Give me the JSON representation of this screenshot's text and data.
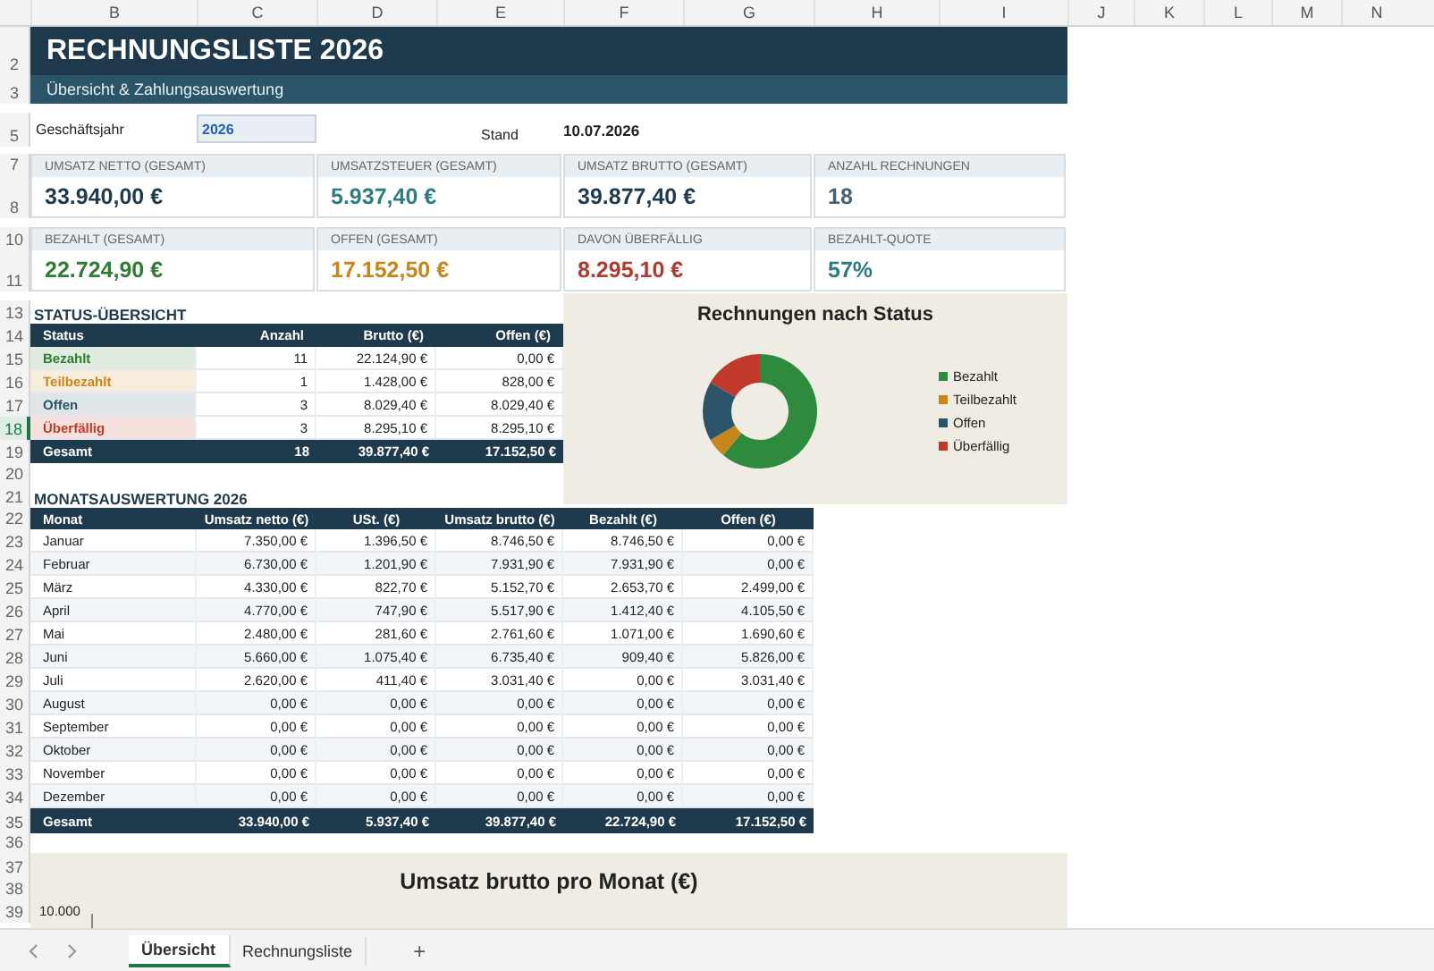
{
  "column_headers": [
    "B",
    "C",
    "D",
    "E",
    "F",
    "G",
    "H",
    "I",
    "J",
    "K",
    "L",
    "M",
    "N"
  ],
  "row_headers": [
    {
      "label": "2",
      "selected": false
    },
    {
      "label": "3",
      "selected": false
    },
    {
      "label": "5",
      "selected": false
    },
    {
      "label": "7",
      "selected": false
    },
    {
      "label": "8",
      "selected": false
    },
    {
      "label": "10",
      "selected": false
    },
    {
      "label": "11",
      "selected": false
    },
    {
      "label": "13",
      "selected": false
    },
    {
      "label": "14",
      "selected": false
    },
    {
      "label": "15",
      "selected": false
    },
    {
      "label": "16",
      "selected": false
    },
    {
      "label": "17",
      "selected": false
    },
    {
      "label": "18",
      "selected": true
    },
    {
      "label": "19",
      "selected": false
    },
    {
      "label": "20",
      "selected": false
    },
    {
      "label": "21",
      "selected": false
    },
    {
      "label": "22",
      "selected": false
    },
    {
      "label": "23",
      "selected": false
    },
    {
      "label": "24",
      "selected": false
    },
    {
      "label": "25",
      "selected": false
    },
    {
      "label": "26",
      "selected": false
    },
    {
      "label": "27",
      "selected": false
    },
    {
      "label": "28",
      "selected": false
    },
    {
      "label": "29",
      "selected": false
    },
    {
      "label": "30",
      "selected": false
    },
    {
      "label": "31",
      "selected": false
    },
    {
      "label": "32",
      "selected": false
    },
    {
      "label": "33",
      "selected": false
    },
    {
      "label": "34",
      "selected": false
    },
    {
      "label": "35",
      "selected": false
    },
    {
      "label": "36",
      "selected": false
    },
    {
      "label": "37",
      "selected": false
    },
    {
      "label": "38",
      "selected": false
    },
    {
      "label": "39",
      "selected": false
    }
  ],
  "title": "RECHNUNGSLISTE 2026",
  "subtitle": "Übersicht & Zahlungsauswertung",
  "fiscal_year": {
    "label": "Geschäftsjahr",
    "value": "2026"
  },
  "as_of": {
    "label": "Stand",
    "value": "10.07.2026"
  },
  "kpis": [
    {
      "label": "UMSATZ NETTO (GESAMT)",
      "value": "33.940,00 €",
      "color": "#1f3a4d"
    },
    {
      "label": "UMSATZSTEUER (GESAMT)",
      "value": "5.937,40 €",
      "color": "#2e7d7d"
    },
    {
      "label": "UMSATZ BRUTTO (GESAMT)",
      "value": "39.877,40 €",
      "color": "#1f3a4d"
    },
    {
      "label": "ANZAHL RECHNUNGEN",
      "value": "18",
      "color": "#4a6070"
    },
    {
      "label": "BEZAHLT (GESAMT)",
      "value": "22.724,90 €",
      "color": "#2e7d32"
    },
    {
      "label": "OFFEN (GESAMT)",
      "value": "17.152,50 €",
      "color": "#c8861a"
    },
    {
      "label": "DAVON ÜBERFÄLLIG",
      "value": "8.295,10 €",
      "color": "#b03a2e"
    },
    {
      "label": "BEZAHLT-QUOTE",
      "value": "57%",
      "color": "#2e7d7d"
    }
  ],
  "status_overview": {
    "title": "STATUS-ÜBERSICHT",
    "columns": [
      "Status",
      "Anzahl",
      "Brutto (€)",
      "Offen (€)"
    ],
    "rows": [
      {
        "status": "Bezahlt",
        "color": "#2e7d32",
        "count": "11",
        "gross": "22.124,90 €",
        "open": "0,00 €"
      },
      {
        "status": "Teilbezahlt",
        "color": "#c8861a",
        "count": "1",
        "gross": "1.428,00 €",
        "open": "828,00 €"
      },
      {
        "status": "Offen",
        "color": "#2b5468",
        "count": "3",
        "gross": "8.029,40 €",
        "open": "8.029,40 €"
      },
      {
        "status": "Überfällig",
        "color": "#c0392b",
        "count": "3",
        "gross": "8.295,10 €",
        "open": "8.295,10 €"
      }
    ],
    "total": [
      "Gesamt",
      "18",
      "39.877,40 €",
      "17.152,50 €"
    ]
  },
  "status_chart": {
    "chart_data": {
      "type": "donut",
      "title": "Rechnungen nach Status",
      "categories": [
        "Bezahlt",
        "Teilbezahlt",
        "Offen",
        "Überfällig"
      ],
      "values": [
        61.1,
        5.6,
        16.7,
        16.6
      ],
      "colors": [
        "#2e8b3e",
        "#c8861a",
        "#2b5468",
        "#c0392b"
      ]
    }
  },
  "monthly": {
    "title": "MONATSAUSWERTUNG 2026",
    "columns": [
      "Monat",
      "Umsatz netto (€)",
      "USt. (€)",
      "Umsatz brutto (€)",
      "Bezahlt (€)",
      "Offen (€)"
    ],
    "rows": [
      [
        "Januar",
        "7.350,00 €",
        "1.396,50 €",
        "8.746,50 €",
        "8.746,50 €",
        "0,00 €"
      ],
      [
        "Februar",
        "6.730,00 €",
        "1.201,90 €",
        "7.931,90 €",
        "7.931,90 €",
        "0,00 €"
      ],
      [
        "März",
        "4.330,00 €",
        "822,70 €",
        "5.152,70 €",
        "2.653,70 €",
        "2.499,00 €"
      ],
      [
        "April",
        "4.770,00 €",
        "747,90 €",
        "5.517,90 €",
        "1.412,40 €",
        "4.105,50 €"
      ],
      [
        "Mai",
        "2.480,00 €",
        "281,60 €",
        "2.761,60 €",
        "1.071,00 €",
        "1.690,60 €"
      ],
      [
        "Juni",
        "5.660,00 €",
        "1.075,40 €",
        "6.735,40 €",
        "909,40 €",
        "5.826,00 €"
      ],
      [
        "Juli",
        "2.620,00 €",
        "411,40 €",
        "3.031,40 €",
        "0,00 €",
        "3.031,40 €"
      ],
      [
        "August",
        "0,00 €",
        "0,00 €",
        "0,00 €",
        "0,00 €",
        "0,00 €"
      ],
      [
        "September",
        "0,00 €",
        "0,00 €",
        "0,00 €",
        "0,00 €",
        "0,00 €"
      ],
      [
        "Oktober",
        "0,00 €",
        "0,00 €",
        "0,00 €",
        "0,00 €",
        "0,00 €"
      ],
      [
        "November",
        "0,00 €",
        "0,00 €",
        "0,00 €",
        "0,00 €",
        "0,00 €"
      ],
      [
        "Dezember",
        "0,00 €",
        "0,00 €",
        "0,00 €",
        "0,00 €",
        "0,00 €"
      ]
    ],
    "total": [
      "Gesamt",
      "33.940,00 €",
      "5.937,40 €",
      "39.877,40 €",
      "22.724,90 €",
      "17.152,50 €"
    ]
  },
  "revenue_chart": {
    "title": "Umsatz brutto pro Monat (€)",
    "y_tick": "10.000"
  },
  "sheet_tabs": [
    {
      "label": "Übersicht",
      "selected": true
    },
    {
      "label": "Rechnungsliste",
      "selected": false
    }
  ],
  "add_sheet": "+"
}
